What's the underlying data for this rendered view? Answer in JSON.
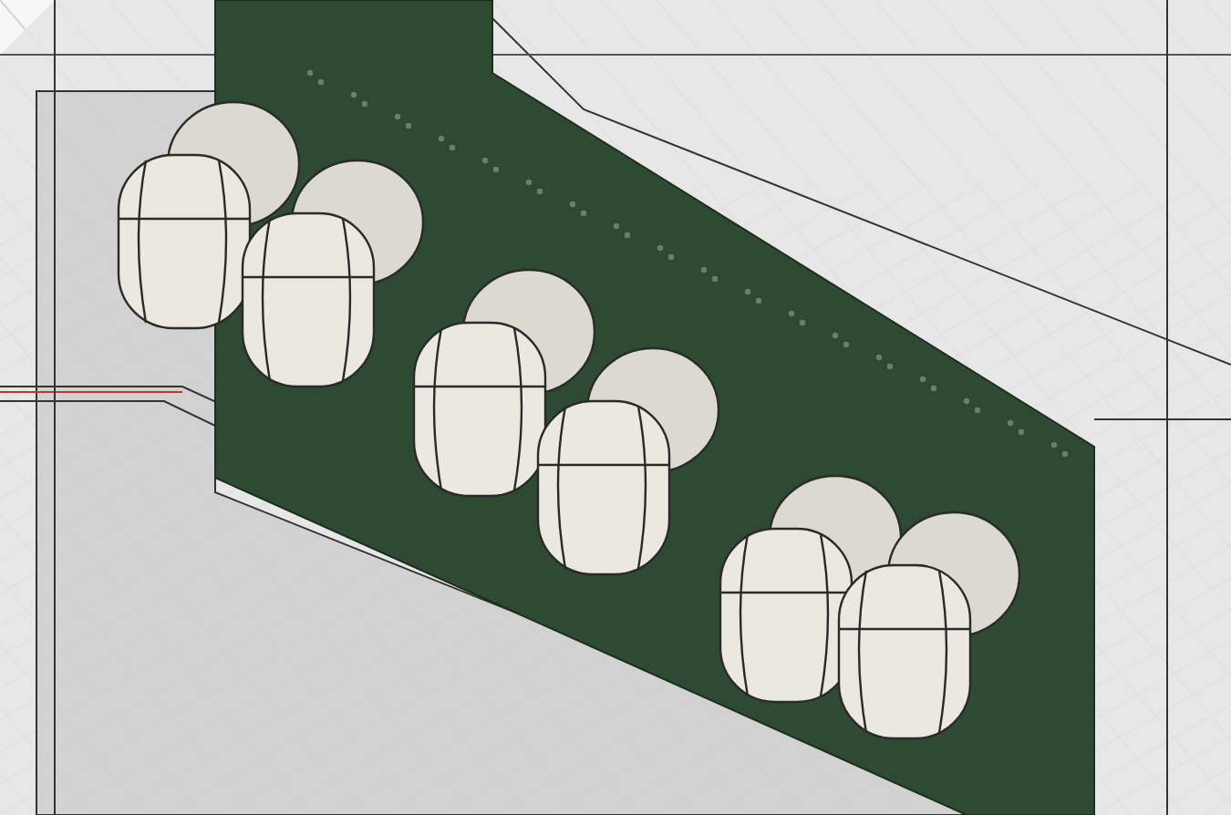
{
  "viewport": {
    "tubes": [
      {
        "kind": "nixie"
      },
      {
        "kind": "nixie"
      },
      {
        "kind": "nixie"
      },
      {
        "kind": "nixie"
      },
      {
        "kind": "nixie"
      },
      {
        "kind": "nixie"
      }
    ]
  }
}
